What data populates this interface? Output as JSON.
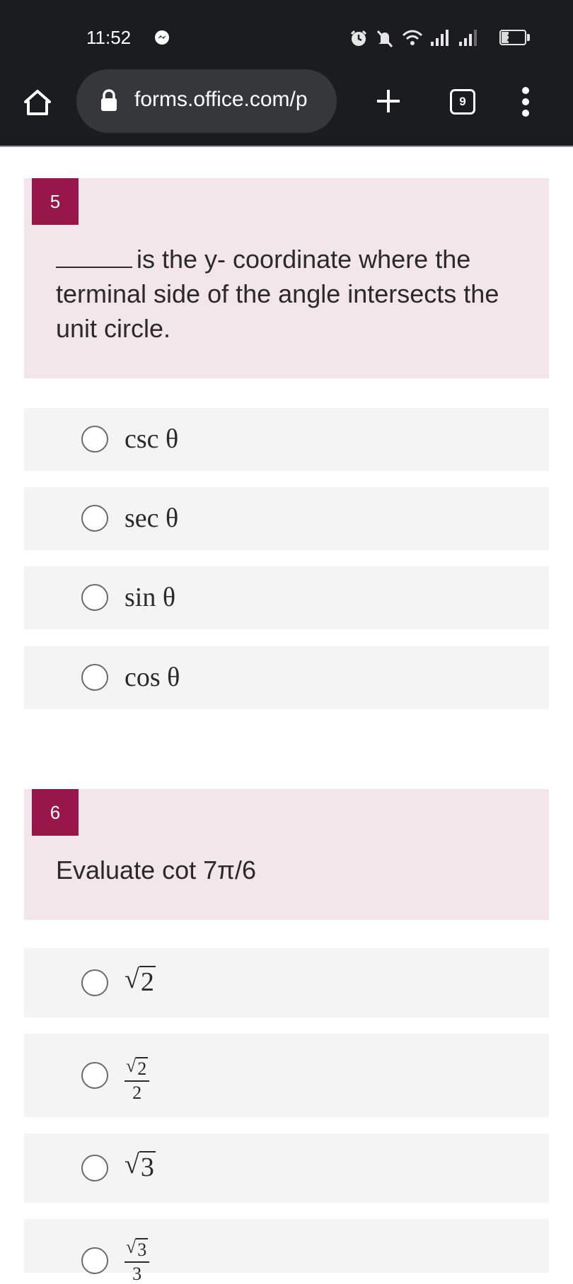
{
  "status_bar": {
    "time": "11:52",
    "battery": "28"
  },
  "browser": {
    "url": "forms.office.com/p",
    "tab_count": "9"
  },
  "questions": [
    {
      "number": "5",
      "text": "is the y- coordinate where the terminal side of the angle intersects the unit circle.",
      "options": [
        "csc θ",
        "sec θ",
        "sin θ",
        "cos θ"
      ]
    },
    {
      "number": "6",
      "text": "Evaluate cot 7π/6",
      "options": [
        {
          "radicand": "2"
        },
        {
          "radicand": "2",
          "denominator": "2"
        },
        {
          "radicand": "3"
        },
        {
          "radicand": "3",
          "denominator": "3"
        }
      ]
    }
  ],
  "colors": {
    "chrome": "#1b1c1f",
    "urlbar": "#36373b",
    "question_card": "#f3e6ea",
    "number_badge": "#98174a",
    "option_bg": "#f4f4f4"
  }
}
